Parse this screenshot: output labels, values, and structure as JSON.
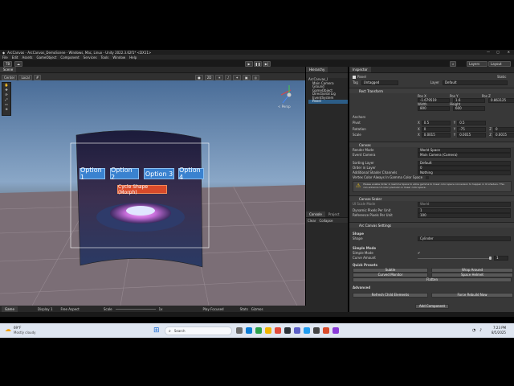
{
  "window": {
    "title": "ArcCanvas - ArcCanvas_DemoScene - Windows, Mac, Linux - Unity 2022.3.62f1* <DX11>"
  },
  "menu": [
    "File",
    "Edit",
    "Assets",
    "GameObject",
    "Component",
    "Services",
    "Tools",
    "Window",
    "Help"
  ],
  "toolbar": {
    "account": "TB",
    "layers_label": "Layers",
    "layout_label": "Layout"
  },
  "scene": {
    "tab_label": "Scene",
    "shading": "Center",
    "space": "Local",
    "view_2d": "2D",
    "gizmo_label": "< Persp",
    "options": [
      "Option 1",
      "Option 2",
      "Option 3",
      "Option 4"
    ],
    "cycle_button": "Cycle Shape (Morph)"
  },
  "game_bar": {
    "tab": "Game",
    "display": "Display 1",
    "aspect": "Free Aspect",
    "scale_label": "Scale",
    "scale_value": "1x",
    "play_focused": "Play Focused",
    "stats": "Stats",
    "gizmos": "Gizmos"
  },
  "hierarchy": {
    "tab_label": "Hierarchy",
    "items": [
      "ArcCanvas_I",
      "Main Camera",
      "Ground",
      "GameObject",
      "Directional Lig",
      "EventSystem",
      "Panel"
    ]
  },
  "project": {
    "tabs": [
      "Console",
      "Project"
    ],
    "buttons": [
      "Clear",
      "Collapse"
    ]
  },
  "inspector": {
    "tab_label": "Inspector",
    "name": "Panel",
    "static_label": "Static",
    "tag_label": "Tag",
    "tag_value": "Untagged",
    "layer_label": "Layer",
    "layer_value": "Default",
    "rect_transform": {
      "header": "Rect Transform",
      "pos_labels": [
        "Pos X",
        "Pos Y",
        "Pos Z"
      ],
      "pos_values": [
        "-1.679519",
        "1.6",
        "0.863125"
      ],
      "width_label": "Width",
      "width_value": "800",
      "height_label": "Height",
      "height_value": "600",
      "anchors_label": "Anchors",
      "pivot_label": "Pivot",
      "pivot_x": "0.5",
      "pivot_y": "0.5",
      "rotation_label": "Rotation",
      "rot_x": "0",
      "rot_y": "-75",
      "rot_z": "0",
      "scale_label": "Scale",
      "scale_x": "0.0015",
      "scale_y": "0.0015",
      "scale_z": "0.0015",
      "axis_x": "X",
      "axis_y": "Y",
      "axis_z": "Z"
    },
    "canvas": {
      "header": "Canvas",
      "render_mode_label": "Render Mode",
      "render_mode_value": "World Space",
      "event_camera_label": "Event Camera",
      "event_camera_value": "Main Camera (Camera)",
      "sorting_layer_label": "Sorting Layer",
      "sorting_layer_value": "Default",
      "order_label": "Order in Layer",
      "order_value": "0",
      "shader_channels_label": "Additional Shader Channels",
      "shader_channels_value": "Nothing",
      "vertex_color_label": "Vertex Color Always In Gamma Color Space",
      "warning": "Please enable Order in Gamma Space to allow gamma to linear color space conversion to happen in UI shaders. This can enhance UI color precision in linear color space."
    },
    "canvas_scaler": {
      "header": "Canvas Scaler",
      "ui_scale_label": "UI Scale Mode",
      "ui_scale_value": "World",
      "dpu_label": "Dynamic Pixels Per Unit",
      "dpu_value": "1",
      "rppu_label": "Reference Pixels Per Unit",
      "rppu_value": "100"
    },
    "arc_settings": {
      "header": "Arc Canvas Settings",
      "shape_section": "Shape",
      "shape_label": "Shape",
      "shape_value": "Cylinder",
      "simple_mode_section": "Simple Mode",
      "simple_mode_label": "Simple Mode",
      "curve_amount_label": "Curve Amount",
      "curve_amount_value": "1",
      "curve_amount_fraction": 1.0,
      "quick_presets_label": "Quick Presets",
      "presets": [
        "Subtle",
        "Wrap Around",
        "Curved Monitor",
        "Space Helmet",
        "Flatten"
      ],
      "advanced_label": "Advanced",
      "refresh_button": "Refresh Child Elements",
      "rebuild_button": "Force Rebuild Now"
    },
    "add_component": "Add Component"
  },
  "taskbar": {
    "weather_temp": "69°F",
    "weather_desc": "Mostly cloudy",
    "search_placeholder": "Search",
    "time": "7:23 PM",
    "date": "8/5/2025"
  }
}
